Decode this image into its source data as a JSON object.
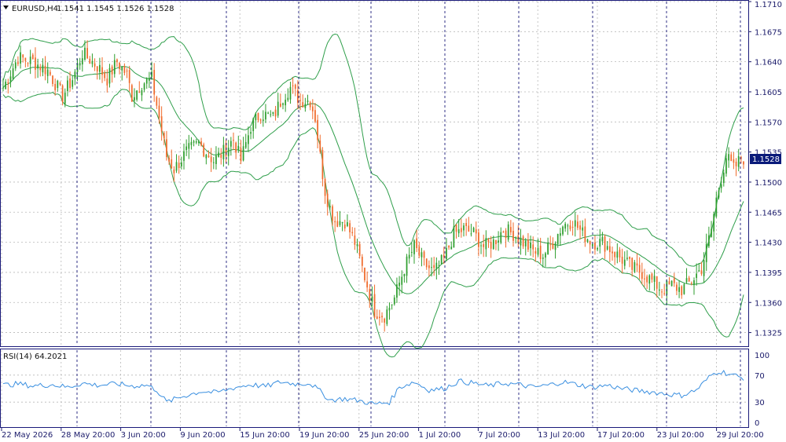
{
  "header": {
    "symbol": "EURUSD,H4",
    "ohlc": "1.1541 1.1545 1.1526 1.1528",
    "arrow_icon": "triangle-down-icon"
  },
  "price_axis": {
    "labels": [
      "1.1710",
      "1.1675",
      "1.1640",
      "1.1605",
      "1.1570",
      "1.1535",
      "1.1500",
      "1.1465",
      "1.1430",
      "1.1395",
      "1.1360",
      "1.1325"
    ],
    "current_price": "1.1528"
  },
  "rsi": {
    "label": "RSI(14) 64.2021",
    "axis_labels": [
      "100",
      "70",
      "30",
      "0"
    ]
  },
  "time_axis": {
    "labels": [
      "22 May 2026",
      "28 May 20:00",
      "3 Jun 20:00",
      "9 Jun 20:00",
      "15 Jun 20:00",
      "19 Jun 20:00",
      "25 Jun 20:00",
      "1 Jul 20:00",
      "7 Jul 20:00",
      "13 Jul 20:00",
      "17 Jul 20:00",
      "23 Jul 20:00",
      "29 Jul 20:00"
    ]
  },
  "colors": {
    "bull": "#2e9e2e",
    "bear": "#f06a2a",
    "band": "#2e9e4a",
    "rsi_line": "#3a8fe0",
    "grid": "#b8b8b8",
    "separator": "#1a1a7a",
    "axis_text": "#1a1a6a",
    "price_tag_bg": "#0a1a7a"
  },
  "chart_data": {
    "type": "candlestick",
    "title": "EURUSD,H4",
    "ylim": [
      1.131,
      1.171
    ],
    "rsi_ylim": [
      0,
      100
    ],
    "close_path": [
      [
        0,
        1.161
      ],
      [
        6,
        1.1645
      ],
      [
        12,
        1.164
      ],
      [
        18,
        1.163
      ],
      [
        22,
        1.161
      ],
      [
        24,
        1.16
      ],
      [
        28,
        1.162
      ],
      [
        32,
        1.165
      ],
      [
        38,
        1.1635
      ],
      [
        42,
        1.162
      ],
      [
        46,
        1.164
      ],
      [
        50,
        1.1625
      ],
      [
        52,
        1.16
      ],
      [
        56,
        1.1615
      ],
      [
        60,
        1.162
      ],
      [
        63,
        1.1575
      ],
      [
        66,
        1.153
      ],
      [
        69,
        1.1515
      ],
      [
        74,
        1.1535
      ],
      [
        79,
        1.1545
      ],
      [
        85,
        1.1525
      ],
      [
        89,
        1.1535
      ],
      [
        93,
        1.155
      ],
      [
        96,
        1.1525
      ],
      [
        100,
        1.1565
      ],
      [
        104,
        1.158
      ],
      [
        109,
        1.1575
      ],
      [
        113,
        1.16
      ],
      [
        116,
        1.161
      ],
      [
        120,
        1.1595
      ],
      [
        124,
        1.1595
      ],
      [
        126,
        1.1575
      ],
      [
        128,
        1.153
      ],
      [
        130,
        1.149
      ],
      [
        132,
        1.147
      ],
      [
        134,
        1.1455
      ],
      [
        138,
        1.1455
      ],
      [
        142,
        1.143
      ],
      [
        146,
        1.139
      ],
      [
        150,
        1.135
      ],
      [
        154,
        1.1345
      ],
      [
        158,
        1.1365
      ],
      [
        162,
        1.14
      ],
      [
        166,
        1.1425
      ],
      [
        170,
        1.1405
      ],
      [
        174,
        1.1395
      ],
      [
        178,
        1.141
      ],
      [
        182,
        1.144
      ],
      [
        186,
        1.1445
      ],
      [
        190,
        1.144
      ],
      [
        194,
        1.1425
      ],
      [
        198,
        1.143
      ],
      [
        202,
        1.1445
      ],
      [
        206,
        1.144
      ],
      [
        210,
        1.143
      ],
      [
        214,
        1.142
      ],
      [
        218,
        1.1415
      ],
      [
        222,
        1.143
      ],
      [
        226,
        1.145
      ],
      [
        230,
        1.1455
      ],
      [
        234,
        1.144
      ],
      [
        238,
        1.143
      ],
      [
        242,
        1.143
      ],
      [
        246,
        1.142
      ],
      [
        250,
        1.141
      ],
      [
        254,
        1.14
      ],
      [
        258,
        1.1395
      ],
      [
        262,
        1.1385
      ],
      [
        266,
        1.1375
      ],
      [
        270,
        1.138
      ],
      [
        274,
        1.1375
      ],
      [
        278,
        1.1385
      ],
      [
        282,
        1.14
      ],
      [
        286,
        1.1445
      ],
      [
        288,
        1.148
      ],
      [
        290,
        1.1505
      ],
      [
        292,
        1.153
      ],
      [
        295,
        1.1515
      ],
      [
        298,
        1.1528
      ]
    ],
    "rsi_path": [
      [
        0,
        55
      ],
      [
        6,
        57
      ],
      [
        12,
        54
      ],
      [
        20,
        56
      ],
      [
        26,
        52
      ],
      [
        32,
        58
      ],
      [
        38,
        55
      ],
      [
        46,
        57
      ],
      [
        52,
        54
      ],
      [
        58,
        55
      ],
      [
        62,
        48
      ],
      [
        66,
        30
      ],
      [
        72,
        38
      ],
      [
        80,
        46
      ],
      [
        86,
        44
      ],
      [
        94,
        52
      ],
      [
        100,
        56
      ],
      [
        106,
        53
      ],
      [
        112,
        60
      ],
      [
        118,
        57
      ],
      [
        124,
        58
      ],
      [
        128,
        46
      ],
      [
        132,
        33
      ],
      [
        138,
        35
      ],
      [
        144,
        32
      ],
      [
        150,
        27
      ],
      [
        156,
        30
      ],
      [
        160,
        52
      ],
      [
        166,
        60
      ],
      [
        172,
        48
      ],
      [
        178,
        50
      ],
      [
        184,
        61
      ],
      [
        190,
        58
      ],
      [
        196,
        54
      ],
      [
        202,
        58
      ],
      [
        208,
        56
      ],
      [
        214,
        52
      ],
      [
        220,
        55
      ],
      [
        226,
        60
      ],
      [
        232,
        56
      ],
      [
        238,
        52
      ],
      [
        244,
        55
      ],
      [
        250,
        50
      ],
      [
        256,
        47
      ],
      [
        262,
        45
      ],
      [
        268,
        42
      ],
      [
        274,
        40
      ],
      [
        280,
        48
      ],
      [
        286,
        70
      ],
      [
        289,
        76
      ],
      [
        292,
        73
      ],
      [
        295,
        70
      ],
      [
        298,
        66
      ]
    ],
    "n_bars": 300
  }
}
